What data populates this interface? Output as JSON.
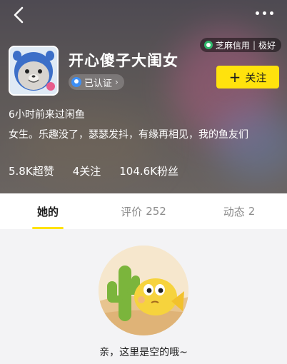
{
  "header": {
    "credit": {
      "label": "芝麻信用",
      "separator": "|",
      "level": "极好"
    },
    "name": "开心傻子大闺女",
    "verified": {
      "label": "已认证",
      "chevron": "›"
    },
    "follow_button": {
      "plus": "+",
      "label": "关注"
    },
    "last_seen": "6小时前来过闲鱼",
    "bio": "女生。乐趣没了，瑟瑟发抖，有缘再相见，我的鱼友们",
    "stats": [
      {
        "text": "5.8K超赞"
      },
      {
        "text": "4关注"
      },
      {
        "text": "104.6K粉丝"
      }
    ]
  },
  "tabs": [
    {
      "label": "她的",
      "count": "",
      "active": true
    },
    {
      "label": "评价",
      "count": "252",
      "active": false
    },
    {
      "label": "动态",
      "count": "2",
      "active": false
    }
  ],
  "empty_state": {
    "message": "亲，这里是空的哦~"
  },
  "colors": {
    "accent": "#ffe20d",
    "text_primary": "#1d1d1d",
    "text_secondary": "#8c8c8c",
    "verified_blue": "#3d8ff5",
    "credit_green": "#2fb56a"
  },
  "icons": {
    "back": "back-arrow-icon",
    "more": "more-dots-icon",
    "credit": "zhima-credit-icon",
    "verified": "verified-badge-icon"
  }
}
